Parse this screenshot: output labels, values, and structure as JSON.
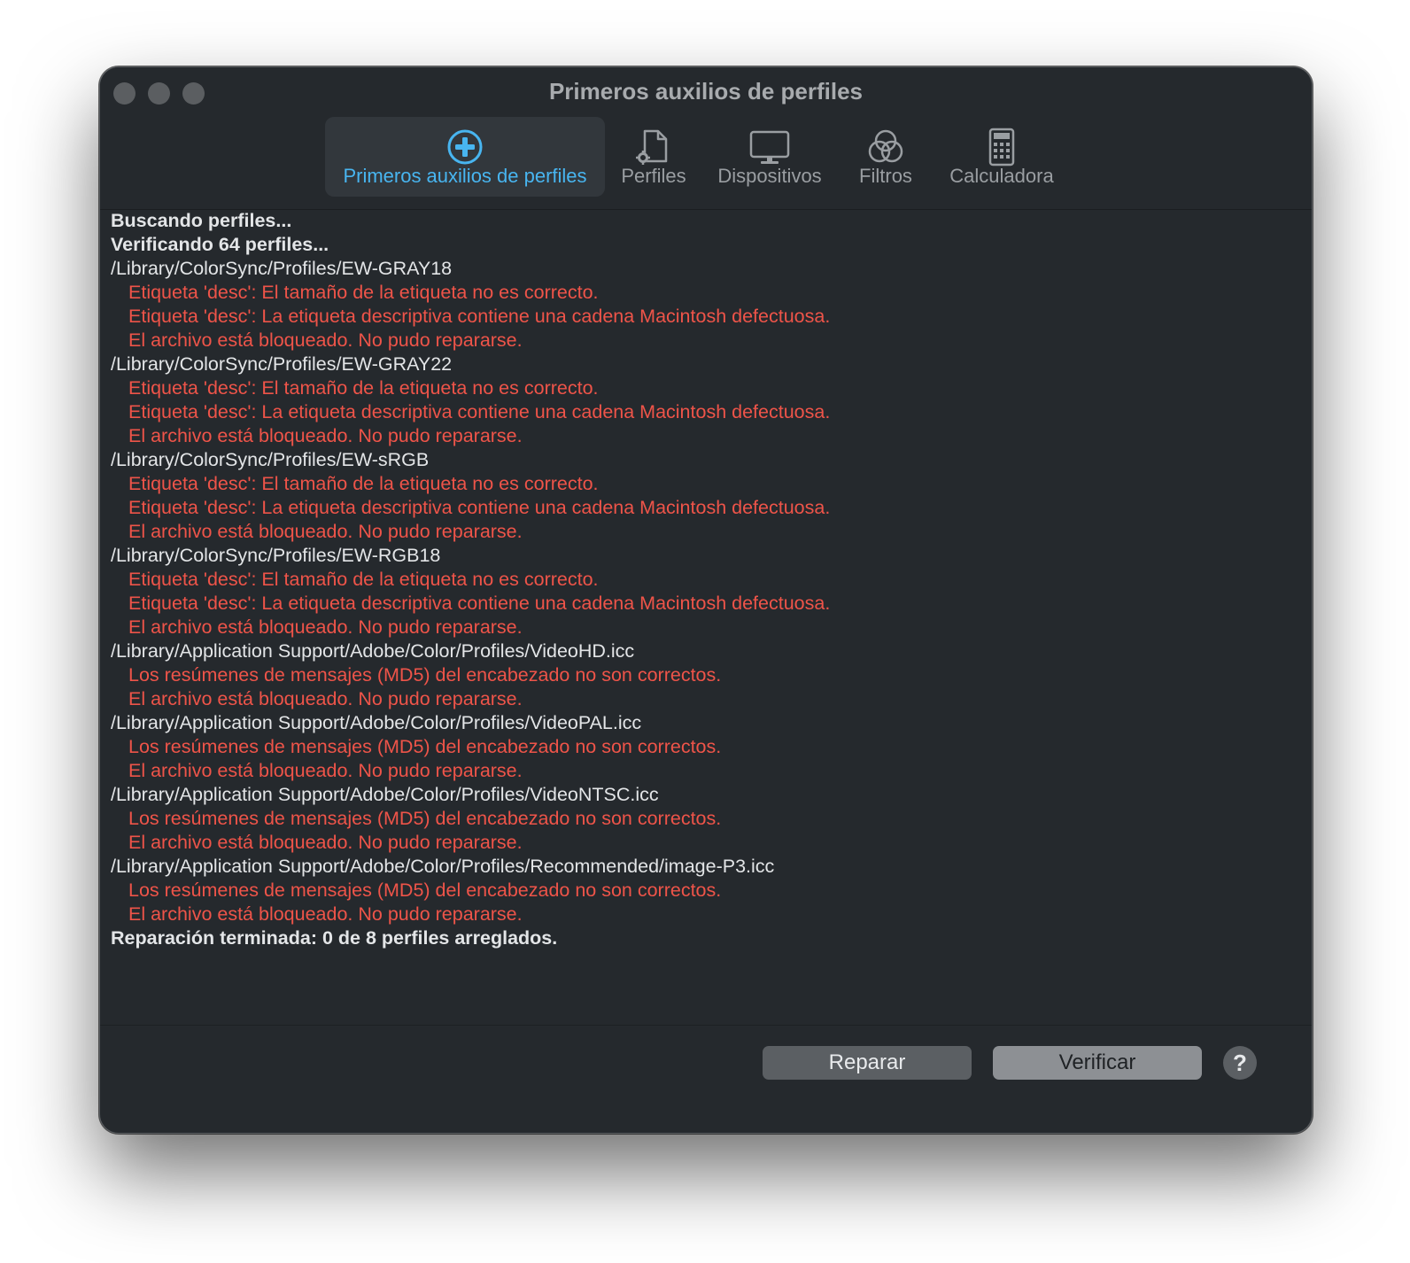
{
  "window": {
    "title": "Primeros auxilios de perfiles"
  },
  "toolbar": {
    "items": [
      {
        "label": "Primeros auxilios de perfiles",
        "icon": "first-aid-plus-icon",
        "active": true
      },
      {
        "label": "Perfiles",
        "icon": "document-gear-icon",
        "active": false
      },
      {
        "label": "Dispositivos",
        "icon": "monitor-icon",
        "active": false
      },
      {
        "label": "Filtros",
        "icon": "rgb-circles-icon",
        "active": false
      },
      {
        "label": "Calculadora",
        "icon": "calculator-icon",
        "active": false
      }
    ]
  },
  "log": {
    "lines": [
      {
        "type": "bold",
        "text": "Buscando perfiles..."
      },
      {
        "type": "bold",
        "text": "Verificando 64 perfiles..."
      },
      {
        "type": "path",
        "text": "/Library/ColorSync/Profiles/EW-GRAY18"
      },
      {
        "type": "err",
        "text": "Etiqueta 'desc': El tamaño de la etiqueta no es correcto."
      },
      {
        "type": "err",
        "text": "Etiqueta 'desc': La etiqueta descriptiva contiene una cadena Macintosh defectuosa."
      },
      {
        "type": "err",
        "text": "El archivo está bloqueado. No pudo repararse."
      },
      {
        "type": "path",
        "text": "/Library/ColorSync/Profiles/EW-GRAY22"
      },
      {
        "type": "err",
        "text": "Etiqueta 'desc': El tamaño de la etiqueta no es correcto."
      },
      {
        "type": "err",
        "text": "Etiqueta 'desc': La etiqueta descriptiva contiene una cadena Macintosh defectuosa."
      },
      {
        "type": "err",
        "text": "El archivo está bloqueado. No pudo repararse."
      },
      {
        "type": "path",
        "text": "/Library/ColorSync/Profiles/EW-sRGB"
      },
      {
        "type": "err",
        "text": "Etiqueta 'desc': El tamaño de la etiqueta no es correcto."
      },
      {
        "type": "err",
        "text": "Etiqueta 'desc': La etiqueta descriptiva contiene una cadena Macintosh defectuosa."
      },
      {
        "type": "err",
        "text": "El archivo está bloqueado. No pudo repararse."
      },
      {
        "type": "path",
        "text": "/Library/ColorSync/Profiles/EW-RGB18"
      },
      {
        "type": "err",
        "text": "Etiqueta 'desc': El tamaño de la etiqueta no es correcto."
      },
      {
        "type": "err",
        "text": "Etiqueta 'desc': La etiqueta descriptiva contiene una cadena Macintosh defectuosa."
      },
      {
        "type": "err",
        "text": "El archivo está bloqueado. No pudo repararse."
      },
      {
        "type": "path",
        "text": "/Library/Application Support/Adobe/Color/Profiles/VideoHD.icc"
      },
      {
        "type": "err",
        "text": "Los resúmenes de mensajes (MD5) del encabezado no son correctos."
      },
      {
        "type": "err",
        "text": "El archivo está bloqueado. No pudo repararse."
      },
      {
        "type": "path",
        "text": "/Library/Application Support/Adobe/Color/Profiles/VideoPAL.icc"
      },
      {
        "type": "err",
        "text": "Los resúmenes de mensajes (MD5) del encabezado no son correctos."
      },
      {
        "type": "err",
        "text": "El archivo está bloqueado. No pudo repararse."
      },
      {
        "type": "path",
        "text": "/Library/Application Support/Adobe/Color/Profiles/VideoNTSC.icc"
      },
      {
        "type": "err",
        "text": "Los resúmenes de mensajes (MD5) del encabezado no son correctos."
      },
      {
        "type": "err",
        "text": "El archivo está bloqueado. No pudo repararse."
      },
      {
        "type": "path",
        "text": "/Library/Application Support/Adobe/Color/Profiles/Recommended/image-P3.icc"
      },
      {
        "type": "err",
        "text": "Los resúmenes de mensajes (MD5) del encabezado no son correctos."
      },
      {
        "type": "err",
        "text": "El archivo está bloqueado. No pudo repararse."
      },
      {
        "type": "bold",
        "text": "Reparación terminada: 0 de 8 perfiles arreglados."
      }
    ]
  },
  "buttons": {
    "repair": "Reparar",
    "verify": "Verificar",
    "help": "?"
  },
  "colors": {
    "accent": "#48b5f0",
    "error": "#ee5449",
    "background": "#25292d"
  }
}
